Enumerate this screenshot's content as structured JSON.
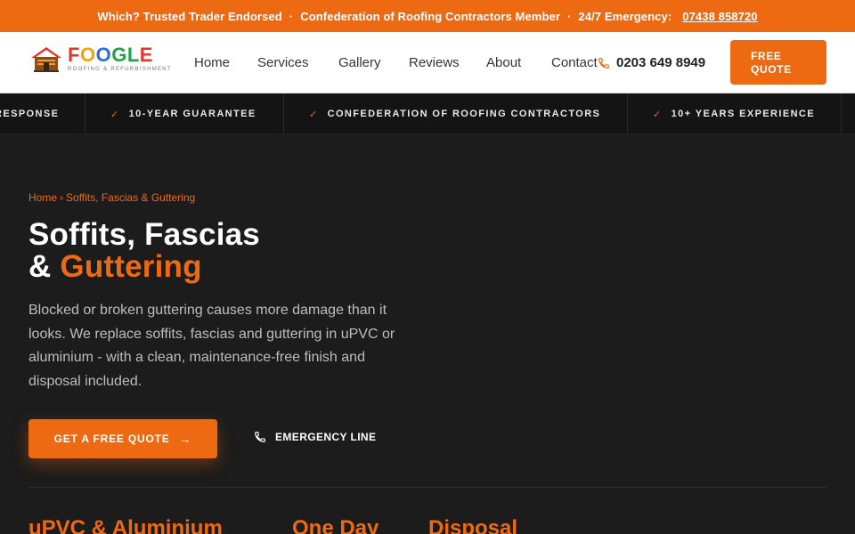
{
  "topbar": {
    "item1": "Which? Trusted Trader Endorsed",
    "item2": "Confederation of Roofing Contractors Member",
    "item3": "24/7 Emergency:",
    "emergency_phone": "07438 858720",
    "separator": "·"
  },
  "header": {
    "logo": {
      "letters": [
        "F",
        "O",
        "O",
        "G",
        "L",
        "E"
      ],
      "tagline": "Roofing & Refurbishment"
    },
    "nav": [
      "Home",
      "Services",
      "Gallery",
      "Reviews",
      "About",
      "Contact"
    ],
    "phone": "0203 649 8949",
    "quote_button": {
      "line1": "FREE",
      "line2": "QUOTE"
    }
  },
  "ticker": {
    "items": [
      "RESPONSE",
      "10-YEAR GUARANTEE",
      "CONFEDERATION OF ROOFING CONTRACTORS",
      "10+ YEARS EXPERIENCE"
    ]
  },
  "hero": {
    "breadcrumb": {
      "home": "Home",
      "separator": "›",
      "current": "Soffits, Fascias & Guttering"
    },
    "title": {
      "line1": "Soffits, Fascias",
      "line2_prefix": "& ",
      "line2_accent": "Guttering"
    },
    "description": "Blocked or broken guttering causes more damage than it looks. We replace soffits, fascias and guttering in uPVC or aluminium - with a clean, maintenance-free finish and disposal included.",
    "cta_primary": "GET A FREE QUOTE",
    "cta_secondary": "EMERGENCY LINE"
  },
  "stats": [
    "uPVC & Aluminium",
    "One Day",
    "Disposal"
  ],
  "colors": {
    "accent": "#ed6a12",
    "background": "#1c1c1c",
    "ticker_bg": "#141414"
  }
}
